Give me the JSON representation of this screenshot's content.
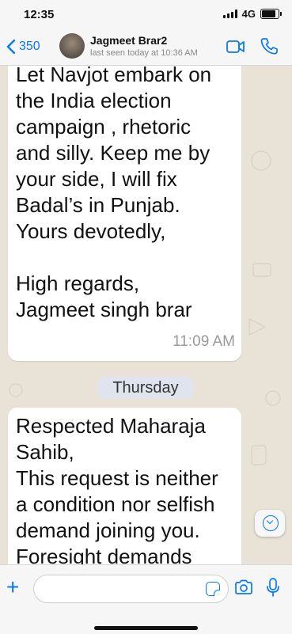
{
  "status": {
    "time": "12:35",
    "network": "4G",
    "battery_level": 0.85
  },
  "header": {
    "back_label": "350",
    "contact_name": "Jagmeet Brar2",
    "last_seen": "last seen today at 10:36 AM"
  },
  "chat": {
    "message1": {
      "lines": [
        "Let Navjot embark on",
        "the India election",
        "campaign , rhetoric",
        "and silly. Keep me by",
        "your side, I will fix",
        "Badal’s in Punjab.",
        "Yours devotedly,",
        "",
        "High regards,",
        "Jagmeet singh brar"
      ],
      "time": "11:09 AM"
    },
    "day_separator": "Thursday",
    "message2": {
      "lines": [
        "Respected Maharaja",
        "Sahib,",
        "This request is neither",
        "a condition nor selfish",
        "demand joining you.",
        "Foresight demands"
      ]
    }
  },
  "composer": {
    "placeholder": ""
  },
  "colors": {
    "accent": "#0a78f5",
    "chat_background": "#e9e2d7",
    "bubble": "#ffffff"
  }
}
